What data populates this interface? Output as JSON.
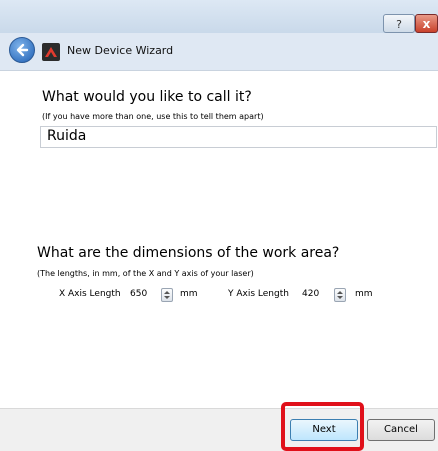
{
  "titlebar": {
    "help_label": "?",
    "close_label": "x"
  },
  "header": {
    "title": "New Device Wizard"
  },
  "name_section": {
    "question": "What would you like to call it?",
    "hint": "(If you have more than one, use this to tell them apart)",
    "value": "Ruida"
  },
  "dimensions_section": {
    "question": "What are the dimensions of the work area?",
    "hint": "(The lengths, in mm, of the X and Y axis of your laser)",
    "x_label": "X Axis Length",
    "x_value": "650",
    "x_unit": "mm",
    "y_label": "Y Axis Length",
    "y_value": "420",
    "y_unit": "mm"
  },
  "footer": {
    "next_label": "Next",
    "cancel_label": "Cancel"
  },
  "colors": {
    "highlight": "#e0101a",
    "header_bg": "#dfe8f3"
  }
}
